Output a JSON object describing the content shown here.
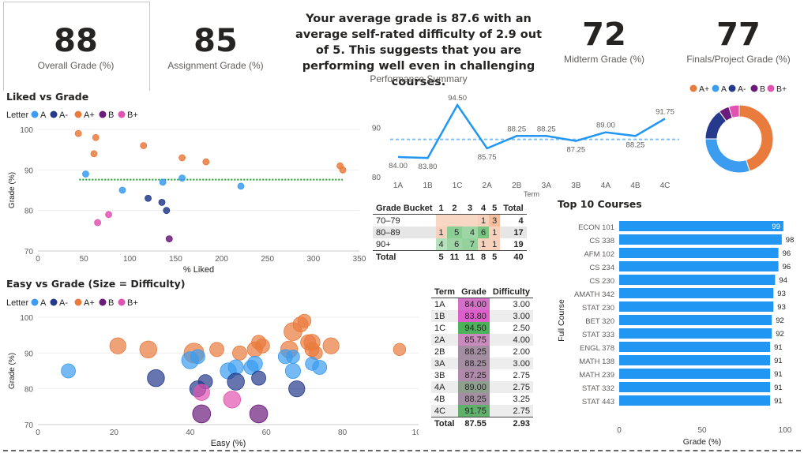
{
  "kpis": [
    {
      "value": "88",
      "label": "Overall Grade (%)"
    },
    {
      "value": "85",
      "label": "Assignment Grade (%)"
    },
    {
      "value": "72",
      "label": "Midterm Grade (%)"
    },
    {
      "value": "77",
      "label": "Finals/Project Grade (%)"
    }
  ],
  "summary": {
    "text": "Your average grade is 87.6 with an average self-rated difficulty of 2.9 out of 5. This suggests that you are performing well even in challenging courses.",
    "caption": "Performance Summary"
  },
  "colors": {
    "A": "#3b9cf0",
    "A-": "#253a8c",
    "A+": "#e97b3d",
    "B": "#6b1c7a",
    "B+": "#e252b0",
    "accent": "#2196f3"
  },
  "legend_title": "Letter",
  "chart_data": [
    {
      "id": "liked",
      "type": "scatter",
      "title": "Liked vs Grade",
      "xlabel": "% Liked",
      "ylabel": "Grade (%)",
      "xlim": [
        0,
        350
      ],
      "ylim": [
        70,
        100
      ],
      "xticks": [
        0,
        50,
        100,
        150,
        200,
        250,
        300,
        350
      ],
      "yticks": [
        70,
        80,
        90,
        100
      ],
      "legend": [
        "A",
        "A-",
        "A+",
        "B",
        "B+"
      ],
      "mean_line": 87.6,
      "points": [
        {
          "x": 44,
          "y": 99,
          "s": "A+"
        },
        {
          "x": 63,
          "y": 98,
          "s": "A+"
        },
        {
          "x": 61,
          "y": 94,
          "s": "A+"
        },
        {
          "x": 115,
          "y": 96,
          "s": "A+"
        },
        {
          "x": 157,
          "y": 93,
          "s": "A+"
        },
        {
          "x": 183,
          "y": 92,
          "s": "A+"
        },
        {
          "x": 329,
          "y": 91,
          "s": "A+"
        },
        {
          "x": 332,
          "y": 90,
          "s": "A+"
        },
        {
          "x": 52,
          "y": 89,
          "s": "A"
        },
        {
          "x": 92,
          "y": 85,
          "s": "A"
        },
        {
          "x": 136,
          "y": 87,
          "s": "A"
        },
        {
          "x": 157,
          "y": 88,
          "s": "A"
        },
        {
          "x": 221,
          "y": 86,
          "s": "A"
        },
        {
          "x": 120,
          "y": 83,
          "s": "A-"
        },
        {
          "x": 135,
          "y": 82,
          "s": "A-"
        },
        {
          "x": 140,
          "y": 80,
          "s": "A-"
        },
        {
          "x": 143,
          "y": 73,
          "s": "B"
        },
        {
          "x": 77,
          "y": 79,
          "s": "B+"
        },
        {
          "x": 65,
          "y": 77,
          "s": "B+"
        }
      ]
    },
    {
      "id": "easy",
      "type": "scatter",
      "title": "Easy vs Grade (Size = Difficulty)",
      "xlabel": "Easy (%)",
      "ylabel": "Grade (%)",
      "xlim": [
        0,
        100
      ],
      "ylim": [
        70,
        100
      ],
      "xticks": [
        0,
        20,
        40,
        60,
        80,
        100
      ],
      "yticks": [
        70,
        80,
        90,
        100
      ],
      "legend": [
        "A",
        "A-",
        "A+",
        "B",
        "B+"
      ],
      "points": [
        {
          "x": 21,
          "y": 92,
          "s": "A+",
          "d": 3.0
        },
        {
          "x": 29,
          "y": 91,
          "s": "A+",
          "d": 3.25
        },
        {
          "x": 41,
          "y": 90,
          "s": "A+",
          "d": 4.0
        },
        {
          "x": 47,
          "y": 91,
          "s": "A+",
          "d": 2.5
        },
        {
          "x": 53,
          "y": 90,
          "s": "A+",
          "d": 2.5
        },
        {
          "x": 57,
          "y": 91,
          "s": "A+",
          "d": 2.75
        },
        {
          "x": 58,
          "y": 93,
          "s": "A+",
          "d": 2.5
        },
        {
          "x": 59,
          "y": 92,
          "s": "A+",
          "d": 2.5
        },
        {
          "x": 66,
          "y": 91,
          "s": "A+",
          "d": 3.25
        },
        {
          "x": 67,
          "y": 96,
          "s": "A+",
          "d": 3.5
        },
        {
          "x": 69,
          "y": 98,
          "s": "A+",
          "d": 2.75
        },
        {
          "x": 70,
          "y": 99,
          "s": "A+",
          "d": 2.25
        },
        {
          "x": 71,
          "y": 93,
          "s": "A+",
          "d": 2.75
        },
        {
          "x": 72,
          "y": 91,
          "s": "A+",
          "d": 2.5
        },
        {
          "x": 72,
          "y": 93,
          "s": "A+",
          "d": 3.0
        },
        {
          "x": 73,
          "y": 90,
          "s": "A+",
          "d": 2.25
        },
        {
          "x": 77,
          "y": 92,
          "s": "A+",
          "d": 3.0
        },
        {
          "x": 95,
          "y": 91,
          "s": "A+",
          "d": 2.0
        },
        {
          "x": 8,
          "y": 85,
          "s": "A",
          "d": 2.5
        },
        {
          "x": 40,
          "y": 88,
          "s": "A",
          "d": 3.25
        },
        {
          "x": 42,
          "y": 89,
          "s": "A",
          "d": 2.5
        },
        {
          "x": 50,
          "y": 85,
          "s": "A",
          "d": 3.0
        },
        {
          "x": 52,
          "y": 86,
          "s": "A",
          "d": 2.75
        },
        {
          "x": 56,
          "y": 86,
          "s": "A",
          "d": 2.5
        },
        {
          "x": 57,
          "y": 87,
          "s": "A",
          "d": 2.75
        },
        {
          "x": 65,
          "y": 89,
          "s": "A",
          "d": 2.5
        },
        {
          "x": 67,
          "y": 85,
          "s": "A",
          "d": 2.75
        },
        {
          "x": 67,
          "y": 89,
          "s": "A",
          "d": 2.25
        },
        {
          "x": 72,
          "y": 87,
          "s": "A",
          "d": 2.25
        },
        {
          "x": 74,
          "y": 86,
          "s": "A",
          "d": 2.5
        },
        {
          "x": 31,
          "y": 83,
          "s": "A-",
          "d": 3.25
        },
        {
          "x": 42,
          "y": 80,
          "s": "A-",
          "d": 3.0
        },
        {
          "x": 44,
          "y": 82,
          "s": "A-",
          "d": 2.5
        },
        {
          "x": 52,
          "y": 82,
          "s": "A-",
          "d": 3.25
        },
        {
          "x": 58,
          "y": 83,
          "s": "A-",
          "d": 2.5
        },
        {
          "x": 68,
          "y": 80,
          "s": "A-",
          "d": 3.0
        },
        {
          "x": 43,
          "y": 73,
          "s": "B",
          "d": 3.5
        },
        {
          "x": 58,
          "y": 73,
          "s": "B",
          "d": 3.5
        },
        {
          "x": 43,
          "y": 79,
          "s": "B+",
          "d": 3.0
        },
        {
          "x": 51,
          "y": 77,
          "s": "B+",
          "d": 3.25
        }
      ]
    },
    {
      "id": "trend",
      "type": "line",
      "title": "",
      "xlabel": "Term",
      "ylabel": "",
      "categories": [
        "1A",
        "1B",
        "1C",
        "2A",
        "2B",
        "3A",
        "3B",
        "4A",
        "4B",
        "4C"
      ],
      "values": [
        84.0,
        83.8,
        94.5,
        85.75,
        88.25,
        88.25,
        87.25,
        89.0,
        88.25,
        91.75
      ],
      "labels": [
        "84.00",
        "83.80",
        "94.50",
        "85.75",
        "88.25",
        "88.25",
        "87.25",
        "89.00",
        "88.25",
        "91.75"
      ],
      "average": 87.55,
      "ylim": [
        80,
        95
      ],
      "yticks": [
        80,
        90
      ]
    },
    {
      "id": "donut",
      "type": "pie",
      "legend": [
        "A+",
        "A",
        "A-",
        "B",
        "B+"
      ],
      "values": [
        18,
        12,
        6,
        2,
        2
      ]
    },
    {
      "id": "top10",
      "type": "bar",
      "title": "Top 10 Courses",
      "xlabel": "Grade (%)",
      "ylabel": "Full Course",
      "categories": [
        "ECON 101",
        "CS 338",
        "AFM 102",
        "CS 234",
        "CS 230",
        "AMATH 342",
        "STAT 230",
        "BET 320",
        "STAT 333",
        "ENGL 378",
        "MATH 138",
        "MATH 239",
        "STAT 332",
        "STAT 443"
      ],
      "values": [
        99,
        98,
        96,
        96,
        94,
        93,
        93,
        92,
        92,
        91,
        91,
        91,
        91,
        91
      ],
      "xlim": [
        0,
        100
      ],
      "xticks": [
        0,
        50,
        100
      ]
    }
  ],
  "bucket_table": {
    "header": [
      "Grade Bucket",
      "1",
      "2",
      "3",
      "4",
      "5",
      "Total"
    ],
    "rows": [
      {
        "label": "70–79",
        "cells": [
          "",
          "",
          "",
          "1",
          "3"
        ],
        "total": "4",
        "shade": [
          0.3,
          0.3,
          0.3,
          0.35,
          0.5
        ]
      },
      {
        "label": "80–89",
        "cells": [
          "1",
          "5",
          "4",
          "6",
          "1"
        ],
        "total": "17",
        "shade": [
          0.35,
          0.65,
          0.55,
          0.75,
          0.35
        ]
      },
      {
        "label": "90+",
        "cells": [
          "4",
          "6",
          "7",
          "1",
          "1"
        ],
        "total": "19",
        "shade": [
          0.4,
          0.55,
          0.6,
          0.3,
          0.3
        ]
      }
    ],
    "total_row": {
      "label": "Total",
      "cells": [
        "5",
        "11",
        "11",
        "8",
        "5"
      ],
      "total": "40"
    }
  },
  "term_table": {
    "header": [
      "Term",
      "Grade",
      "Difficulty"
    ],
    "rows": [
      {
        "term": "1A",
        "grade": "84.00",
        "difficulty": "3.00",
        "color": "#d470c7"
      },
      {
        "term": "1B",
        "grade": "83.80",
        "difficulty": "3.00",
        "color": "#de5fcb"
      },
      {
        "term": "1C",
        "grade": "94.50",
        "difficulty": "2.50",
        "color": "#4cb35a"
      },
      {
        "term": "2A",
        "grade": "85.75",
        "difficulty": "4.00",
        "color": "#c98bbd"
      },
      {
        "term": "2B",
        "grade": "88.25",
        "difficulty": "2.00",
        "color": "#a48ea1"
      },
      {
        "term": "3A",
        "grade": "88.25",
        "difficulty": "3.00",
        "color": "#a48ea1"
      },
      {
        "term": "3B",
        "grade": "87.25",
        "difficulty": "2.75",
        "color": "#b08aab"
      },
      {
        "term": "4A",
        "grade": "89.00",
        "difficulty": "2.75",
        "color": "#8f9f8e"
      },
      {
        "term": "4B",
        "grade": "88.25",
        "difficulty": "3.25",
        "color": "#a48ea1"
      },
      {
        "term": "4C",
        "grade": "91.75",
        "difficulty": "2.75",
        "color": "#5fb06a"
      }
    ],
    "total": {
      "term": "Total",
      "grade": "87.55",
      "difficulty": "2.93"
    }
  }
}
